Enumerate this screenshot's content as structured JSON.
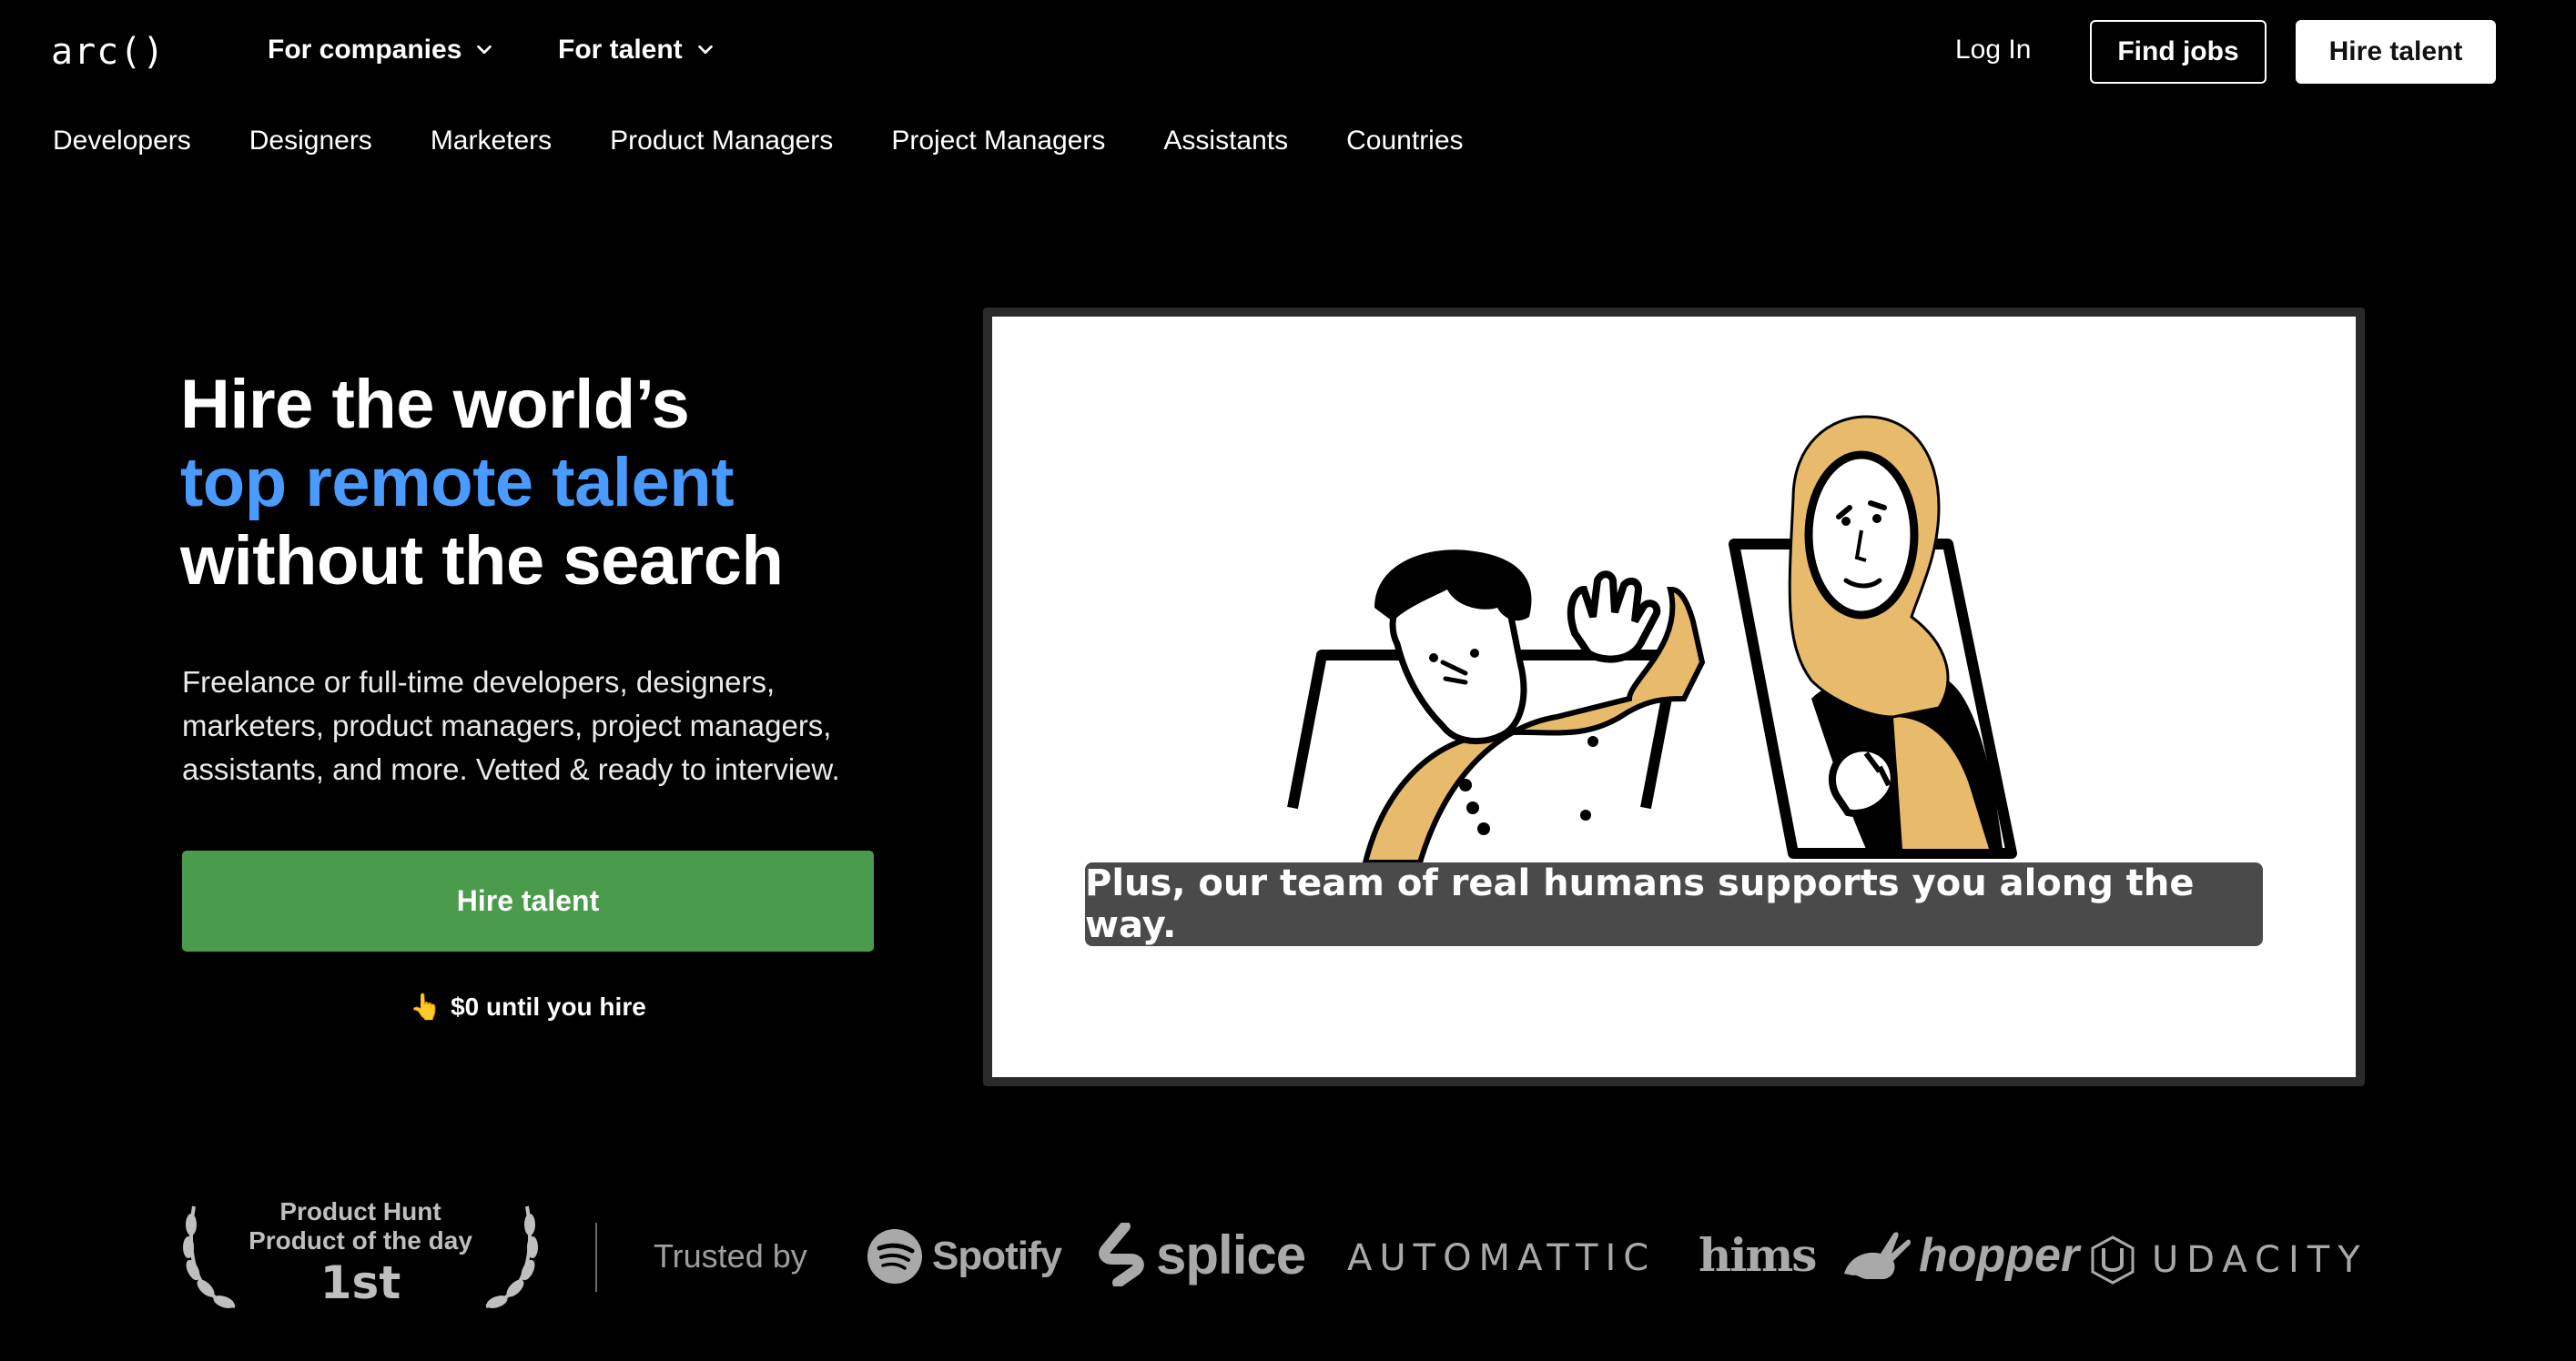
{
  "header": {
    "logo": "arc()",
    "nav": [
      {
        "label": "For companies"
      },
      {
        "label": "For talent"
      }
    ],
    "login_label": "Log In",
    "find_jobs_label": "Find jobs",
    "hire_talent_label": "Hire talent"
  },
  "subnav": [
    "Developers",
    "Designers",
    "Marketers",
    "Product Managers",
    "Project Managers",
    "Assistants",
    "Countries"
  ],
  "hero": {
    "title_line1": "Hire the world’s",
    "title_line2": "top remote talent",
    "title_line3": "without the search",
    "description": "Freelance or full-time developers, designers, marketers, product managers, project managers, assistants, and more. Vetted & ready to interview.",
    "cta_label": "Hire talent",
    "note": "$0 until you hire",
    "note_icon": "pointing-hand-icon",
    "accent_color": "#4a9bff",
    "cta_color": "#4b9b4c"
  },
  "video": {
    "caption": "Plus, our team of real humans supports you along the way."
  },
  "trust": {
    "award_line1": "Product Hunt",
    "award_line2": "Product of the day",
    "award_rank": "1st",
    "trusted_label": "Trusted by",
    "logos": [
      "Spotify",
      "splice",
      "AUTOMATTIC",
      "hims",
      "hopper",
      "UDACITY"
    ]
  }
}
